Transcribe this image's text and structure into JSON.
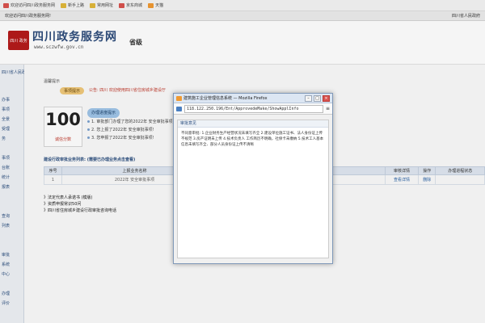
{
  "bookmarks": [
    {
      "label": "欢迎访问四川政务服务网",
      "icon": "site-icon"
    },
    {
      "label": "新手上路",
      "icon": "folder-icon"
    },
    {
      "label": "常用网址",
      "icon": "folder-icon"
    },
    {
      "label": "京东商城",
      "icon": "shop-icon"
    },
    {
      "label": "天猫",
      "icon": "tmall-icon"
    }
  ],
  "site_bar": {
    "welcome": "欢迎访问四川政务服务网!",
    "user": "四川省人民政府"
  },
  "header": {
    "logo_text": "四川 政务",
    "title": "四川政务服务网",
    "url": "www.sczwfw.gov.cn",
    "level": "省级"
  },
  "sidebar": {
    "items": [
      "四川省人民政府",
      "办事",
      "事项",
      "全景",
      "受理",
      "务",
      "事项",
      "台账",
      "统计",
      "报表",
      "查询",
      "列表",
      "审批",
      "系统",
      "中心",
      "办理",
      "评价"
    ]
  },
  "main": {
    "section_title": "温馨提示",
    "notice_pill": "事项提示",
    "notice_text": "公告: 四川 欢迎使用四川省住房城乡建设厅",
    "count": "100",
    "count_label": "诚信分数",
    "steps_pill": "办理进度提示",
    "steps": [
      "1. 审批部门办理了您的2022年 安全审批事项!",
      "2. 您上报了2022年 安全审批事项!",
      "3. 您申报了2022年 安全审批事项!"
    ],
    "table_title": "建设行政审批业务列表: (需要已办理业务点击查看)",
    "table": {
      "headers": [
        "序号",
        "上报业务名称",
        "审核详情",
        "操作",
        "办理进程状态"
      ],
      "rows": [
        [
          "1",
          "2022年 安全审批事项",
          "查看详情",
          "删除",
          ""
        ]
      ]
    },
    "links": [
      "法定代表人承诺书 (模版)",
      "资质申报常识50问",
      "四川省住房城乡建设行政审批咨询电话"
    ]
  },
  "popup": {
    "window_title": "建筑施工企业管理信息系统 — Mozilla Firefox",
    "url": "118.122.250.196/Ent/ApprovedeMake/ShowApplInfo",
    "section_title": "审批意见",
    "body": "不同意审批: 1.企业财务生产经营状况未填写齐全 2.建设单位施工证书、法人身份证上传不规范 3.房产证明未上传 4.技术负责人 工作简历不明确，社保卡未缴纳 5.技术工人基本信息未填写齐全、部分人员身份证上传不清晰"
  }
}
